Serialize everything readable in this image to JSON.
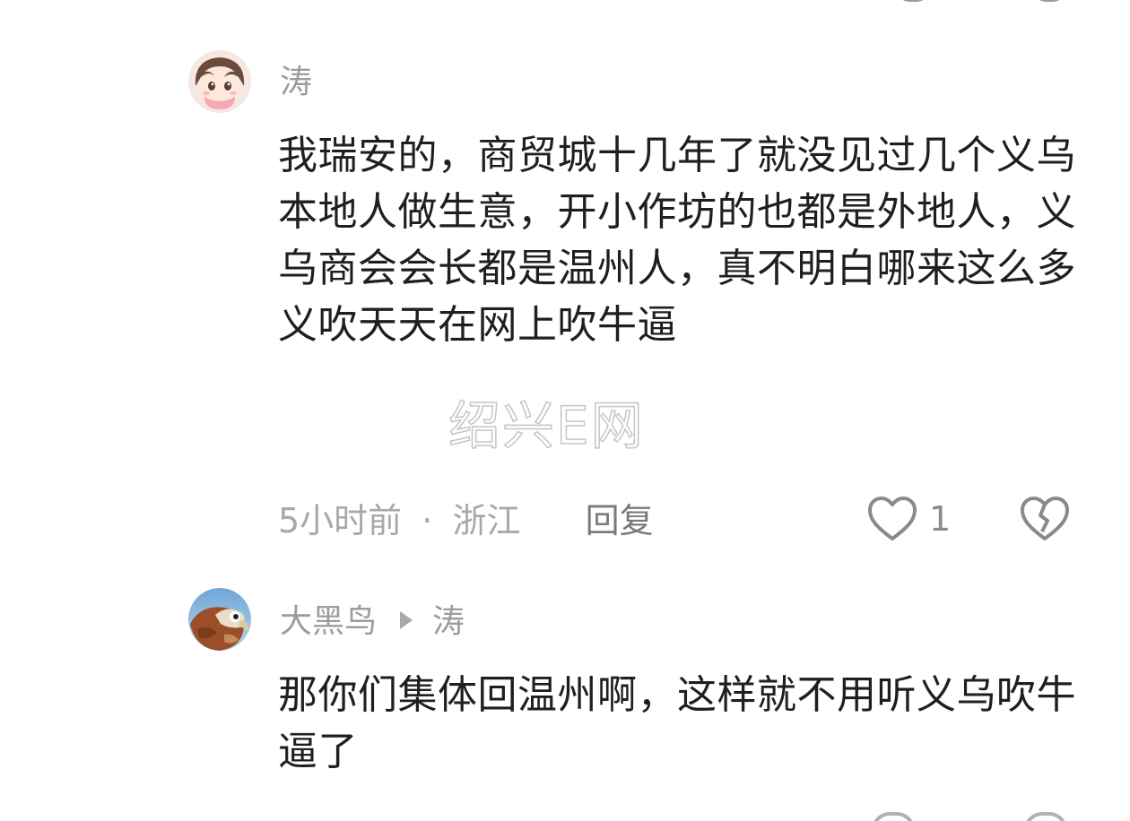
{
  "comments": [
    {
      "username": "涛",
      "avatar": "anime-girl-avatar",
      "text": "我瑞安的，商贸城十几年了就没见过几个义乌本地人做生意，开小作坊的也都是外地人，义乌商会会长都是温州人，真不明白哪来这么多义吹天天在网上吹牛逼",
      "time": "5小时前",
      "separator": "·",
      "location": "浙江",
      "reply_label": "回复",
      "likes": "1"
    },
    {
      "username": "大黑鸟",
      "reply_to": "涛",
      "avatar": "eagle-avatar",
      "text": "那你们集体回温州啊，这样就不用听义乌吹牛逼了"
    }
  ],
  "watermark": "绍兴E网",
  "colors": {
    "text": "#1f1f1f",
    "muted": "#9c9c9c",
    "icon": "#8a8a8a"
  }
}
